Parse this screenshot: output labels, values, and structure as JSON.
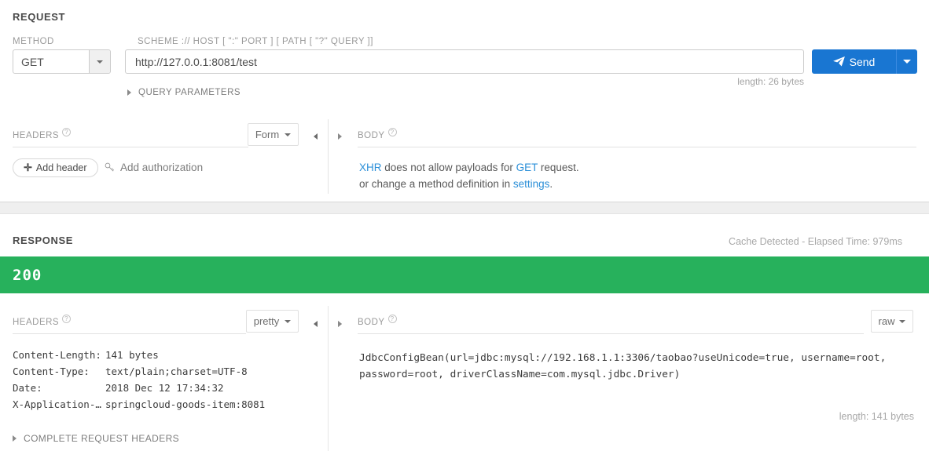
{
  "request": {
    "heading": "REQUEST",
    "method_label": "METHOD",
    "method_value": "GET",
    "url_label": "SCHEME :// HOST [ \":\" PORT ] [ PATH [ \"?\" QUERY ]]",
    "url_value": "http://127.0.0.1:8081/test",
    "url_placeholder": "http://",
    "url_length": "length: 26 bytes",
    "send_label": "Send",
    "query_parameters_label": "QUERY PARAMETERS",
    "headers_title": "HEADERS",
    "headers_format": "Form",
    "add_header_label": "Add header",
    "add_header_plus": "✛",
    "add_authorization_label": "Add authorization",
    "body_title": "BODY",
    "body_message_line1_pre": "XHR",
    "body_message_line1_mid": " does not allow payloads for ",
    "body_message_line1_method": "GET",
    "body_message_line1_post": " request.",
    "body_message_line2_pre": "or change a method definition in ",
    "body_message_line2_link": "settings",
    "body_message_line2_post": "."
  },
  "response": {
    "heading": "RESPONSE",
    "cache_info": "Cache Detected - Elapsed Time: 979ms",
    "status_code": "200",
    "status_color": "#27b15c",
    "headers_title": "HEADERS",
    "headers_format": "pretty",
    "headers": [
      {
        "key": "Content-Length:",
        "value": "141 bytes"
      },
      {
        "key": "Content-Type:",
        "value": "text/plain;charset=UTF-8"
      },
      {
        "key": "Date:",
        "value": "2018 Dec 12 17:34:32"
      },
      {
        "key": "X-Application-…",
        "value": "springcloud-goods-item:8081"
      }
    ],
    "complete_request_headers_label": "COMPLETE REQUEST HEADERS",
    "body_title": "BODY",
    "body_format": "raw",
    "body_text": "JdbcConfigBean(url=jdbc:mysql://192.168.1.1:3306/taobao?useUnicode=true, username=root, password=root, driverClassName=com.mysql.jdbc.Driver)",
    "body_length": "length: 141 bytes"
  },
  "colors": {
    "accent_blue": "#1976d2",
    "link_blue": "#2b8fd8",
    "success_green": "#27b15c"
  }
}
